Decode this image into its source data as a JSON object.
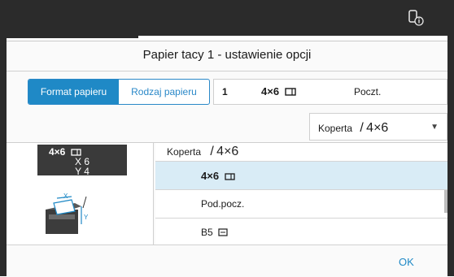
{
  "dialog": {
    "title": "Papier tacy 1 - ustawienie opcji",
    "ok_label": "OK"
  },
  "tabs": [
    {
      "label": "Format papieru",
      "active": true
    },
    {
      "label": "Rodzaj papieru",
      "active": false
    }
  ],
  "summary": {
    "tray_number": "1",
    "size": "4×6",
    "type": "Poczt."
  },
  "dropdown": {
    "category": "Koperta",
    "separator": "/",
    "size": "4×6"
  },
  "size_display": {
    "label": "4×6",
    "x": "X  6",
    "y": "Y  4"
  },
  "list": {
    "header_category": "Koperta",
    "header_separator": "/",
    "header_size": "4×6",
    "items": [
      {
        "label": "4×6",
        "selected": true
      },
      {
        "label": "Pod.pocz.",
        "selected": false
      },
      {
        "label": "B5",
        "selected": false
      }
    ]
  },
  "illustration": {
    "x_label": "X",
    "y_label": "Y"
  },
  "colors": {
    "accent": "#1f89c6",
    "selected_row": "#d9ecf6",
    "topbar": "#2b2b2b"
  },
  "icons": {
    "topbar": "touchpad-info-icon",
    "orientation": "landscape-envelope-icon"
  }
}
